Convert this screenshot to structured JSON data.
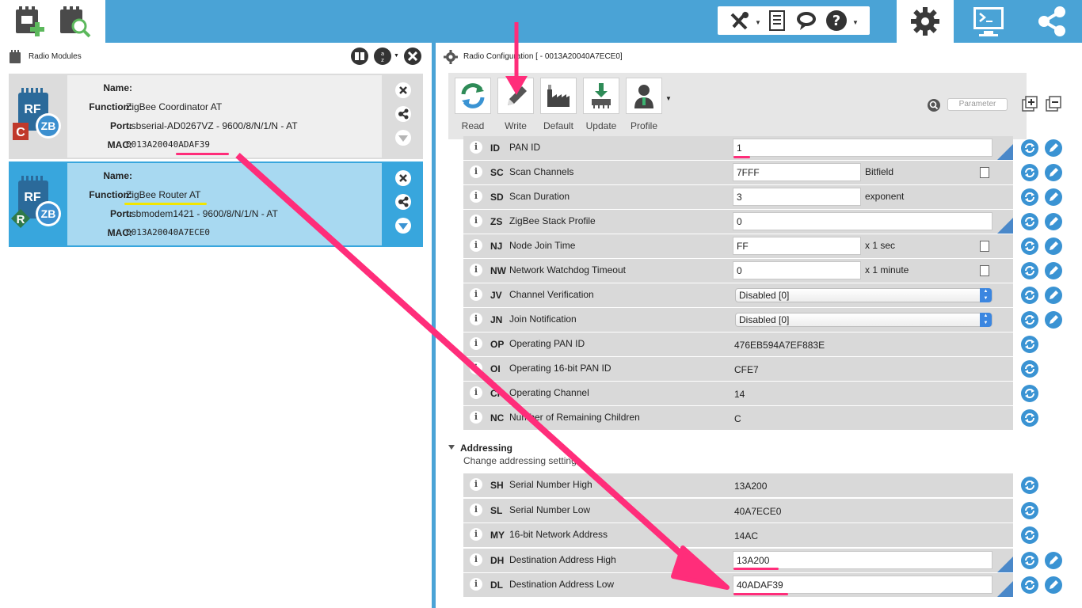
{
  "topbar": {
    "left_icons": [
      "add-device-icon",
      "discover-device-icon"
    ],
    "tools": [
      "tools-icon",
      "file-icon",
      "chat-icon",
      "help-icon"
    ],
    "modes": [
      "configuration-mode-icon",
      "console-mode-icon",
      "network-mode-icon"
    ]
  },
  "left_panel": {
    "title": "Radio Modules",
    "modules": [
      {
        "role_badge": "C",
        "icon_text_1": "RF",
        "icon_text_2": "ZB",
        "name_label": "Name:",
        "name_value": "",
        "function_label": "Function:",
        "function_value": "ZigBee Coordinator AT",
        "port_label": "Port:",
        "port_value": "usbserial-AD0267VZ - 9600/8/N/1/N - AT",
        "mac_label": "MAC:",
        "mac_value": "0013A20040ADAF39"
      },
      {
        "role_badge": "R",
        "icon_text_1": "RF",
        "icon_text_2": "ZB",
        "name_label": "Name:",
        "name_value": "",
        "function_label": "Function:",
        "function_value": "ZigBee Router AT",
        "port_label": "Port:",
        "port_value": "usbmodem1421 - 9600/8/N/1/N - AT",
        "mac_label": "MAC:",
        "mac_value": "0013A20040A7ECE0"
      }
    ]
  },
  "right_panel": {
    "title": "Radio Configuration [  - 0013A20040A7ECE0]",
    "toolbar": {
      "read": "Read",
      "write": "Write",
      "default": "Default",
      "update": "Update",
      "profile": "Profile",
      "search_placeholder": "Parameter"
    },
    "params": [
      {
        "code": "ID",
        "name": "PAN ID",
        "value": "1",
        "type": "input"
      },
      {
        "code": "SC",
        "name": "Scan Channels",
        "value": "7FFF",
        "unit": "Bitfield",
        "type": "input-unit"
      },
      {
        "code": "SD",
        "name": "Scan Duration",
        "value": "3",
        "unit": "exponent",
        "type": "input-unit"
      },
      {
        "code": "ZS",
        "name": "ZigBee Stack Profile",
        "value": "0",
        "type": "input"
      },
      {
        "code": "NJ",
        "name": "Node Join Time",
        "value": "FF",
        "unit": "x 1 sec",
        "type": "input-unit"
      },
      {
        "code": "NW",
        "name": "Network Watchdog Timeout",
        "value": "0",
        "unit": "x 1 minute",
        "type": "input-unit"
      },
      {
        "code": "JV",
        "name": "Channel Verification",
        "value": "Disabled [0]",
        "type": "select"
      },
      {
        "code": "JN",
        "name": "Join Notification",
        "value": "Disabled [0]",
        "type": "select"
      },
      {
        "code": "OP",
        "name": "Operating PAN ID",
        "value": "476EB594A7EF883E",
        "type": "readonly"
      },
      {
        "code": "OI",
        "name": "Operating 16-bit PAN ID",
        "value": "CFE7",
        "type": "readonly"
      },
      {
        "code": "CH",
        "name": "Operating Channel",
        "value": "14",
        "type": "readonly"
      },
      {
        "code": "NC",
        "name": "Number of Remaining Children",
        "value": "C",
        "type": "readonly"
      }
    ],
    "addressing": {
      "title": "Addressing",
      "subtitle": "Change addressing settings",
      "params": [
        {
          "code": "SH",
          "name": "Serial Number High",
          "value": "13A200",
          "type": "readonly"
        },
        {
          "code": "SL",
          "name": "Serial Number Low",
          "value": "40A7ECE0",
          "type": "readonly"
        },
        {
          "code": "MY",
          "name": "16-bit Network Address",
          "value": "14AC",
          "type": "readonly"
        },
        {
          "code": "DH",
          "name": "Destination Address High",
          "value": "13A200",
          "type": "input"
        },
        {
          "code": "DL",
          "name": "Destination Address Low",
          "value": "40ADAF39",
          "type": "input"
        }
      ]
    }
  },
  "colors": {
    "accent_blue": "#4aa3d6",
    "annotation_pink": "#ff2d7a",
    "annotation_yellow": "#f2e600",
    "selected_card": "#38a6dd"
  }
}
